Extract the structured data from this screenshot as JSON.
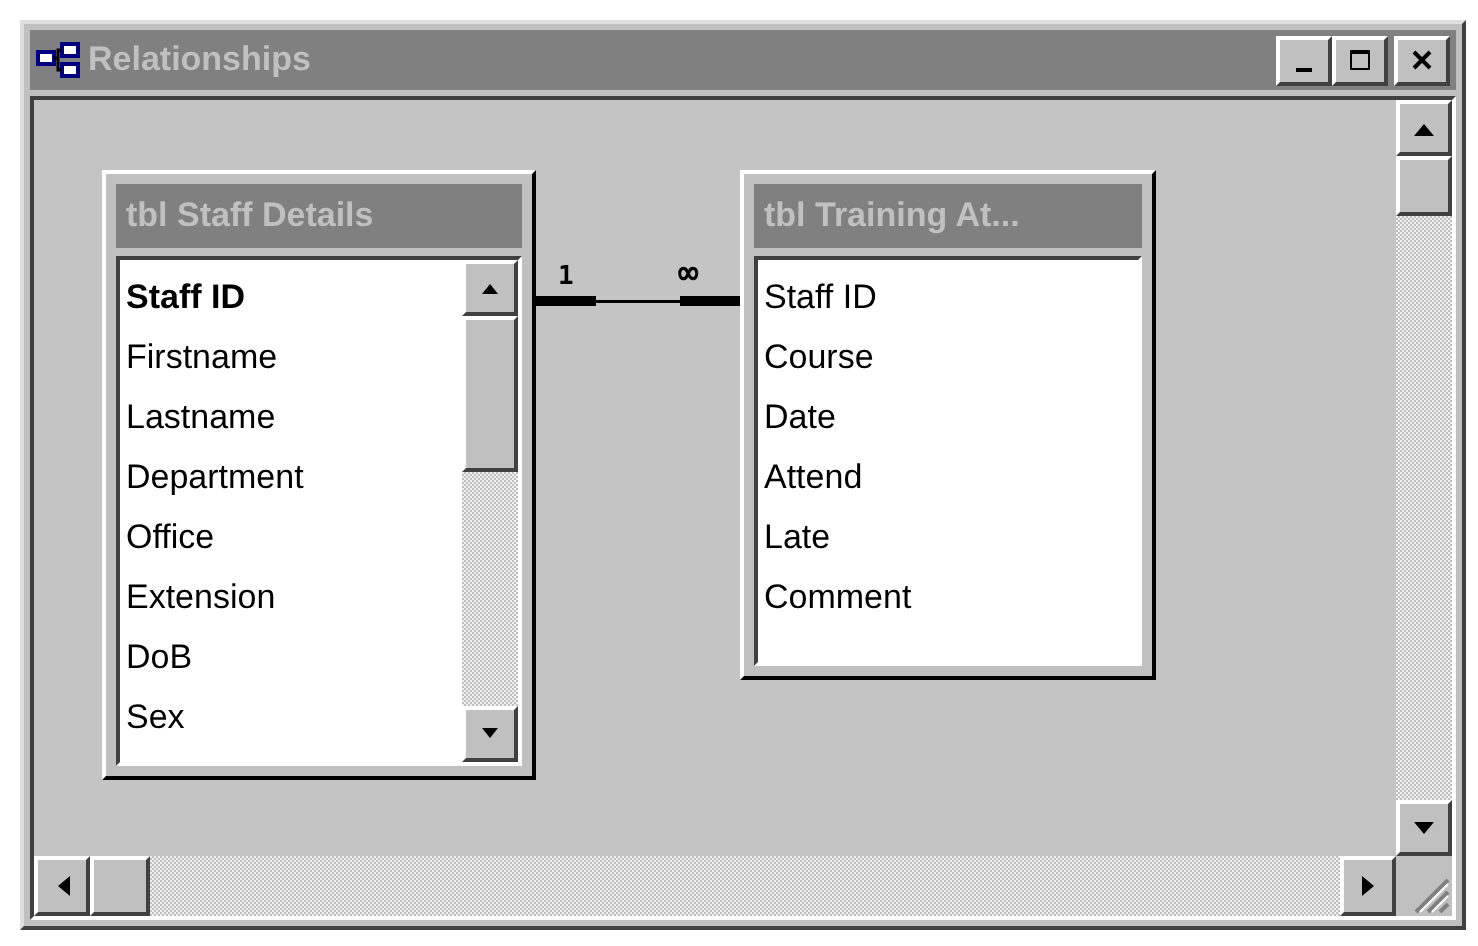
{
  "window": {
    "title": "Relationships",
    "active": false
  },
  "tables": [
    {
      "title": "tbl Staff Details",
      "scrollbar": true,
      "fields": [
        {
          "name": "Staff ID",
          "primary_key": true
        },
        {
          "name": "Firstname",
          "primary_key": false
        },
        {
          "name": "Lastname",
          "primary_key": false
        },
        {
          "name": "Department",
          "primary_key": false
        },
        {
          "name": "Office",
          "primary_key": false
        },
        {
          "name": "Extension",
          "primary_key": false
        },
        {
          "name": "DoB",
          "primary_key": false
        },
        {
          "name": "Sex",
          "primary_key": false
        }
      ]
    },
    {
      "title": "tbl Training At...",
      "scrollbar": false,
      "fields": [
        {
          "name": "Staff ID",
          "primary_key": false
        },
        {
          "name": "Course",
          "primary_key": false
        },
        {
          "name": "Date",
          "primary_key": false
        },
        {
          "name": "Attend",
          "primary_key": false
        },
        {
          "name": "Late",
          "primary_key": false
        },
        {
          "name": "Comment",
          "primary_key": false
        }
      ]
    }
  ],
  "relationship": {
    "one_label": "1",
    "many_label": "∞"
  }
}
